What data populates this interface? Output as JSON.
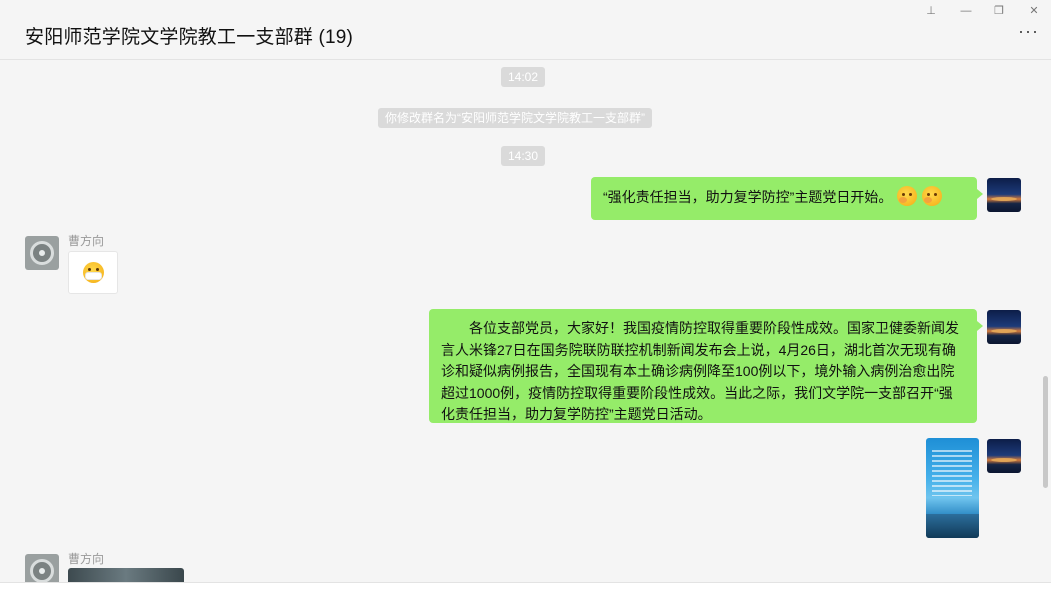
{
  "window": {
    "title": "安阳师范学院文学院教工一支部群 (19)",
    "controls": {
      "pin": "⊥",
      "minimize": "—",
      "restore": "❐",
      "close": "✕"
    },
    "more_label": "···"
  },
  "messages": {
    "time1": "14:02",
    "system_notice": "你修改群名为“安阳师范学院文学院教工一支部群”",
    "time2": "14:30",
    "msg1": {
      "text": "“强化责任担当，助力复学防控”主题党日开始。",
      "emojis": [
        "blush-emoji",
        "blush-emoji"
      ]
    },
    "sender1": "曹方向",
    "sticker1": "face-with-mask-emoji",
    "msg2": {
      "text": "各位支部党员，大家好！我国疫情防控取得重要阶段性成效。国家卫健委新闻发言人米锋27日在国务院联防联控机制新闻发布会上说，4月26日，湖北首次无现有确诊和疑似病例报告，全国现有本土确诊病例降至100例以下，境外输入病例治愈出院超过1000例，疫情防控取得重要阶段性成效。当此之际，我们文学院一支部召开“强化责任担当，助力复学防控”主题党日活动。"
    },
    "sender2": "曹方向"
  },
  "colors": {
    "bubble_self": "#95ec69",
    "background": "#f5f5f5",
    "system_tag": "#dadada"
  }
}
